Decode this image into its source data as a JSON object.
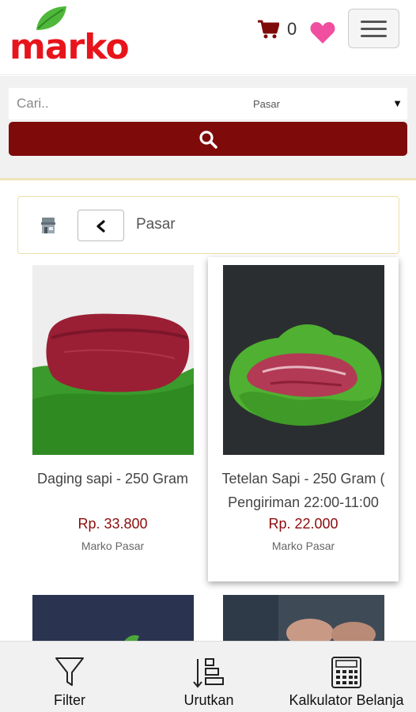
{
  "header": {
    "logo_text": "marko",
    "cart_count": "0",
    "brand_color": "#e8141b",
    "accent_color": "#7e0a0a"
  },
  "search": {
    "placeholder": "Cari..",
    "select_value": "Pasar"
  },
  "breadcrumb": {
    "label": "Pasar"
  },
  "products": [
    {
      "name": "Daging sapi - 250 Gram",
      "price": "Rp. 33.800",
      "seller": "Marko Pasar"
    },
    {
      "name": "Tetelan Sapi - 250 Gram (",
      "name_line2": "Pengiriman 22:00-11:00",
      "price": "Rp. 22.000",
      "seller": "Marko Pasar"
    }
  ],
  "bottom_nav": [
    {
      "label": "Filter",
      "icon": "filter-icon"
    },
    {
      "label": "Urutkan",
      "icon": "sort-icon"
    },
    {
      "label": "Kalkulator Belanja",
      "icon": "calculator-icon"
    }
  ]
}
